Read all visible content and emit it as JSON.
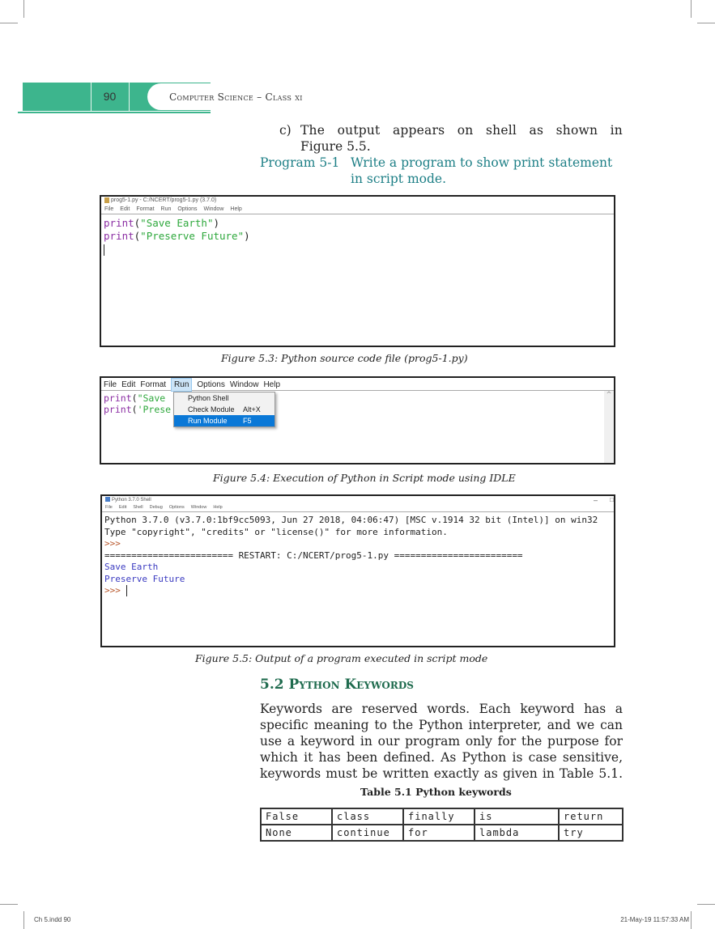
{
  "header": {
    "page_number": "90",
    "book_title": "Computer Science – Class xi"
  },
  "intro": {
    "item_marker": "c)",
    "item_text_line1": "The output appears on shell as shown in",
    "item_text_line2": "Figure 5.5.",
    "program_label": "Program 5-1",
    "program_text_line1": "Write a program to show print statement",
    "program_text_line2": "in script mode."
  },
  "figure_5_3": {
    "window_title": "prog5-1.py - C:/NCERT/prog5-1.py (3.7.0)",
    "menu": [
      "File",
      "Edit",
      "Format",
      "Run",
      "Options",
      "Window",
      "Help"
    ],
    "code_lines": [
      {
        "keyword": "print",
        "open": "(",
        "string": "\"Save Earth\"",
        "close": ")"
      },
      {
        "keyword": "print",
        "open": "(",
        "string": "\"Preserve Future\"",
        "close": ")"
      }
    ],
    "caption": "Figure 5.3:  Python source code file (prog5-1.py)"
  },
  "figure_5_4": {
    "menu": [
      "File",
      "Edit",
      "Format",
      "Run",
      "Options",
      "Window",
      "Help"
    ],
    "active_menu": "Run",
    "code_lines": [
      {
        "keyword": "print",
        "open": "(",
        "string": "\"Save"
      },
      {
        "keyword": "print",
        "open": "(",
        "string": "'Prese"
      }
    ],
    "dropdown": [
      {
        "label": "Python Shell",
        "shortcut": "",
        "selected": false
      },
      {
        "label": "Check Module",
        "shortcut": "Alt+X",
        "selected": false
      },
      {
        "label": "Run Module",
        "shortcut": "F5",
        "selected": true
      }
    ],
    "caption": "Figure 5.4:  Execution of Python in Script mode using IDLE"
  },
  "figure_5_5": {
    "window_title": "Python 3.7.0 Shell",
    "window_controls": [
      "–",
      "□"
    ],
    "menu": [
      "File",
      "Edit",
      "Shell",
      "Debug",
      "Options",
      "Window",
      "Help"
    ],
    "banner_line1": "Python 3.7.0 (v3.7.0:1bf9cc5093, Jun 27 2018, 04:06:47) [MSC v.1914 32 bit (Intel)] on win32",
    "banner_line2": "Type \"copyright\", \"credits\" or \"license()\" for more information.",
    "prompt": ">>>",
    "restart_line": "======================== RESTART: C:/NCERT/prog5-1.py ========================",
    "output_lines": [
      "Save Earth",
      "Preserve Future"
    ],
    "caption": "Figure 5.5:  Output of a program executed in script mode"
  },
  "section": {
    "heading": "5.2 Python Keywords",
    "paragraph_lines": [
      "Keywords are reserved words. Each keyword has a",
      "specific meaning to the Python interpreter, and we can",
      "use a keyword in our program only for the purpose for",
      "which it has been defined. As Python is case sensitive,",
      "keywords must be written exactly as given in Table 5.1."
    ],
    "table_title": "Table 5.1  Python keywords",
    "table_rows": [
      [
        "False",
        "class",
        "finally",
        "is",
        "return"
      ],
      [
        "None",
        "continue",
        "for",
        "lambda",
        "try"
      ]
    ]
  },
  "footer": {
    "left": "Ch 5.indd   90",
    "right": "21-May-19   11:57:33 AM"
  }
}
